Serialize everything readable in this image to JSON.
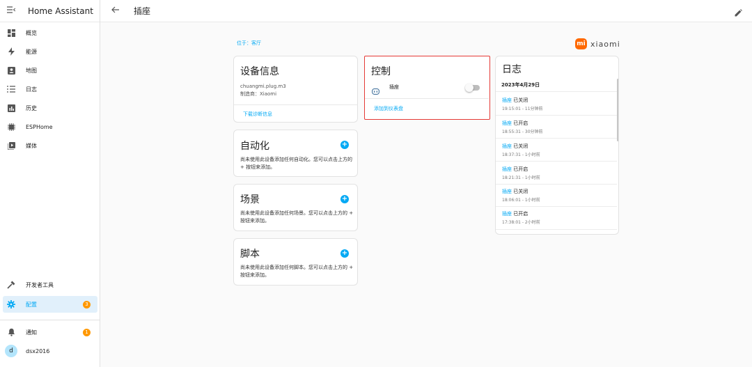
{
  "app": {
    "title": "Home Assistant"
  },
  "sidebar": {
    "items": [
      {
        "label": "概览",
        "icon": "dashboard-icon"
      },
      {
        "label": "能源",
        "icon": "lightning-icon"
      },
      {
        "label": "地图",
        "icon": "map-icon"
      },
      {
        "label": "日志",
        "icon": "list-icon"
      },
      {
        "label": "历史",
        "icon": "chart-icon"
      },
      {
        "label": "ESPHome",
        "icon": "chip-icon"
      },
      {
        "label": "媒体",
        "icon": "media-icon"
      }
    ],
    "dev_tools": "开发者工具",
    "settings": {
      "label": "配置",
      "badge": "3"
    },
    "notifications": {
      "label": "通知",
      "badge": "1"
    },
    "user": {
      "label": "dsx2016",
      "initial": "d"
    }
  },
  "topbar": {
    "title": "插座"
  },
  "location": {
    "prefix": "位于：",
    "area": "客厅"
  },
  "brand": {
    "wordmark": "xiaomi",
    "logo": "mi"
  },
  "device_info": {
    "title": "设备信息",
    "model": "chuangmi.plug.m3",
    "manufacturer": "制造商：Xiaomi",
    "download": "下载诊断信息"
  },
  "automation": {
    "title": "自动化",
    "text": "尚未使用此设备添加任何自动化。您可以点击上方的 + 按钮来添加。"
  },
  "scene": {
    "title": "场景",
    "text": "尚未使用此设备添加任何场景。您可以点击上方的 + 按钮来添加。"
  },
  "script": {
    "title": "脚本",
    "text": "尚未使用此设备添加任何脚本。您可以点击上方的 + 按钮来添加。"
  },
  "control": {
    "title": "控制",
    "entity": "插座",
    "add_to_dashboard": "添加到仪表盘",
    "switch_on": false
  },
  "log": {
    "title": "日志",
    "date": "2023年4月29日",
    "entries": [
      {
        "entity": "插座",
        "state": "已关闭",
        "time": "19:15:01 - 11分钟前"
      },
      {
        "entity": "插座",
        "state": "已开启",
        "time": "18:55:31 - 30分钟前"
      },
      {
        "entity": "插座",
        "state": "已关闭",
        "time": "18:37:31 - 1小时前"
      },
      {
        "entity": "插座",
        "state": "已开启",
        "time": "18:21:31 - 1小时前"
      },
      {
        "entity": "插座",
        "state": "已关闭",
        "time": "18:06:01 - 1小时前"
      },
      {
        "entity": "插座",
        "state": "已开启",
        "time": "17:38:01 - 2小时前"
      }
    ]
  },
  "colors": {
    "accent": "#03a9f4",
    "badge": "#ff9800",
    "highlight": "#e53935",
    "xiaomi": "#ff6900"
  }
}
